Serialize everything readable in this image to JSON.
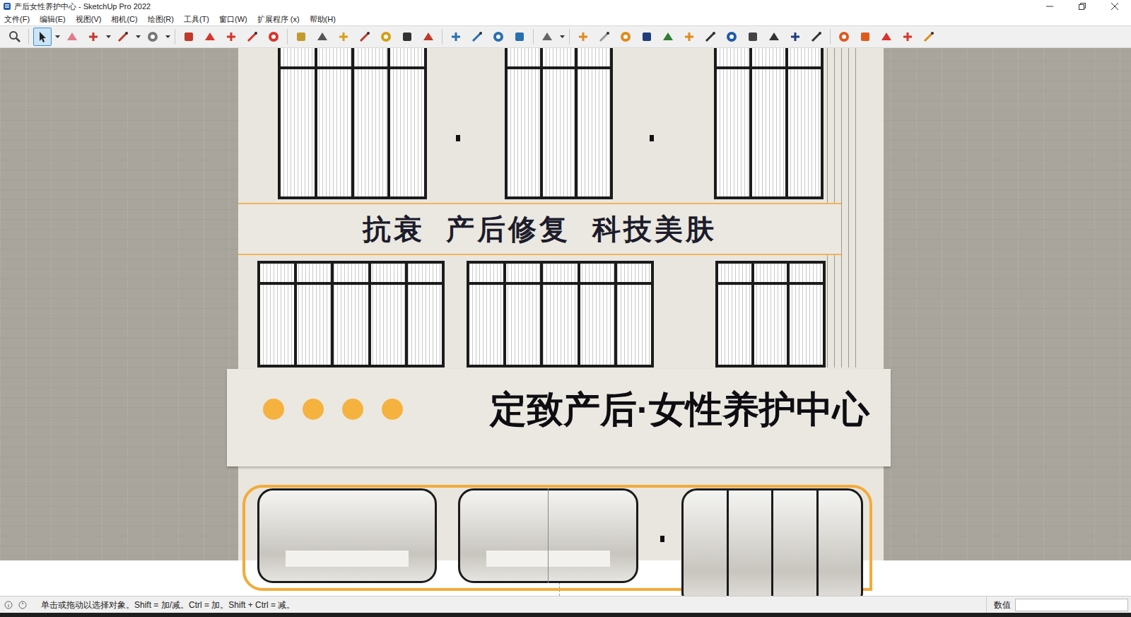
{
  "window": {
    "title": "产后女性养护中心 - SketchUp Pro 2022"
  },
  "menus": [
    "文件(F)",
    "编辑(E)",
    "视图(V)",
    "相机(C)",
    "绘图(R)",
    "工具(T)",
    "窗口(W)",
    "扩展程序 (x)",
    "帮助(H)"
  ],
  "tools": [
    {
      "selected": false,
      "dropdown": false
    },
    {
      "selected": true,
      "dropdown": true
    },
    {
      "selected": false,
      "dropdown": false
    },
    {
      "selected": false,
      "dropdown": true
    },
    {
      "selected": false,
      "dropdown": true
    },
    {
      "selected": false,
      "dropdown": true
    },
    {
      "selected": false,
      "dropdown": false
    },
    {
      "selected": false,
      "dropdown": false
    },
    {
      "selected": false,
      "dropdown": false
    },
    {
      "selected": false,
      "dropdown": false
    },
    {
      "selected": false,
      "dropdown": false
    },
    {
      "selected": false,
      "dropdown": false
    },
    {
      "selected": false,
      "dropdown": false
    },
    {
      "selected": false,
      "dropdown": false
    },
    {
      "selected": false,
      "dropdown": false
    },
    {
      "selected": false,
      "dropdown": false
    },
    {
      "selected": false,
      "dropdown": false
    },
    {
      "selected": false,
      "dropdown": false
    },
    {
      "selected": false,
      "dropdown": false
    },
    {
      "selected": false,
      "dropdown": false
    },
    {
      "selected": false,
      "dropdown": false
    },
    {
      "selected": false,
      "dropdown": false
    },
    {
      "selected": false,
      "dropdown": true
    },
    {
      "selected": false,
      "dropdown": false
    },
    {
      "selected": false,
      "dropdown": false
    },
    {
      "selected": false,
      "dropdown": false
    },
    {
      "selected": false,
      "dropdown": false
    },
    {
      "selected": false,
      "dropdown": false
    },
    {
      "selected": false,
      "dropdown": false
    },
    {
      "selected": false,
      "dropdown": false
    },
    {
      "selected": false,
      "dropdown": false
    },
    {
      "selected": false,
      "dropdown": false
    },
    {
      "selected": false,
      "dropdown": false
    },
    {
      "selected": false,
      "dropdown": false
    },
    {
      "selected": false,
      "dropdown": false
    },
    {
      "selected": false,
      "dropdown": false
    },
    {
      "selected": false,
      "dropdown": false
    },
    {
      "selected": false,
      "dropdown": false
    },
    {
      "selected": false,
      "dropdown": false
    },
    {
      "selected": false,
      "dropdown": false
    }
  ],
  "model": {
    "slogan": "抗衰  产后修复  科技美肤",
    "sign": "定致产后·女性养护中心"
  },
  "status_bar": {
    "hint": "单击或拖动以选择对象。Shift = 加/减。Ctrl = 加。Shift + Ctrl = 减。",
    "measurements_label": "数值",
    "measurements_value": ""
  }
}
